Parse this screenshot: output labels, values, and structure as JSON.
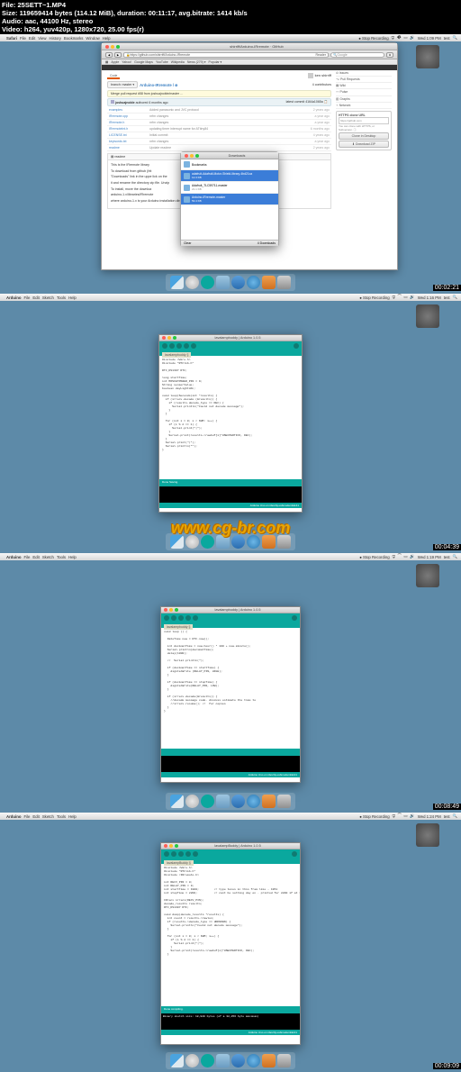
{
  "file_info": {
    "file": "File: 25SETT~1.MP4",
    "size": "Size: 119659414 bytes (114.12 MiB), duration: 00:11:17, avg.bitrate: 1414 kb/s",
    "audio": "Audio: aac, 44100 Hz, stereo",
    "video": "Video: h264, yuv420p, 1280x720, 25.00 fps(r)"
  },
  "timestamps": [
    "00:02:21",
    "00:04:39",
    "00:08:49",
    "00:09:09"
  ],
  "watermark": "www.cg-br.com",
  "panel1": {
    "menubar": {
      "app": "Safari",
      "items": [
        "File",
        "Edit",
        "View",
        "History",
        "Bookmarks",
        "Window",
        "Help"
      ],
      "recording": "● Stop Recording",
      "clock": "Wed 1:09 PM",
      "user": "test"
    },
    "safari": {
      "title": "shirriff/Arduino-IRremote · GitHub",
      "url": "https://github.com/shirriff/Arduino-IRremote",
      "search_ph": "Google",
      "reader": "Reader",
      "bookmarks": [
        "Apple",
        "Yahoo!",
        "Google Maps",
        "YouTube",
        "Wikipedia",
        "News (279) ▾",
        "Popular ▾"
      ],
      "github_nav": [
        "🔍 shirriff ▾",
        "★",
        "🔔"
      ],
      "gh_user": "ken shirriff",
      "tabs": [
        "Code",
        "Network",
        "Pull Requests 5",
        "Issues 25",
        "Wiki",
        "Graphs"
      ],
      "branch_btn": "branch: master ▾",
      "path": "Arduino-IRremote / ⊕",
      "contributors": "4 contributors",
      "merge_msg": "Merge pull request #58 from joshuajnoble/master …",
      "commit_user": "joshuajnoble",
      "commit_age": "authored 6 months ago",
      "latest_commit": "latest commit  4164a1065a 📋",
      "side": {
        "issues": "⊙ Issues",
        "pulls": "⌥ Pull Requests",
        "wiki": "▤ Wiki",
        "pulse": "〰 Pulse",
        "graphs": "▥ Graphs",
        "network": "♆ Network"
      },
      "clone_label": "HTTPS clone URL",
      "clone_url": "https://github.com",
      "clone_note": "You can clone with HTTPS, or Subversion. ⓘ",
      "clone_desktop": "Clone in Desktop",
      "download_zip": "⬇ Download ZIP",
      "files": [
        {
          "name": "examples",
          "msg": "Added panasonic and JVC protocol",
          "age": "2 years ago"
        },
        {
          "name": "IRremote.cpp",
          "msg": "nrfm changes",
          "age": "a year ago"
        },
        {
          "name": "IRremote.h",
          "msg": "nrfm changes",
          "age": "a year ago"
        },
        {
          "name": "IRremoteInt.h",
          "msg": "updating timer interrupt name for ATtiny84",
          "age": "6 months ago"
        },
        {
          "name": "LICENSE.txt",
          "msg": "Initial commit",
          "age": "4 years ago"
        },
        {
          "name": "keywords.txt",
          "msg": "nrfm changes",
          "age": "a year ago"
        },
        {
          "name": "readme",
          "msg": "Update readme",
          "age": "2 years ago"
        }
      ],
      "readme_head": "▤ readme",
      "readme": [
        "This is the IRremote library",
        "To download from github (htt",
        "\"Downloads\" link in the uppe                                                  lick on the",
        "it and rename the directory                                                    zip file. Unzip",
        "To install, move the downloa",
        "arduino-1.x/libraries/IRremote",
        "where arduino-1.x is your Arduino installation directory"
      ]
    },
    "downloads": {
      "title": "Downloads",
      "items": [
        {
          "name": "Bookmarks",
          "sub": ""
        },
        {
          "name": "adafruit-Adafruit-Motor-Shield-library-4bd21ca",
          "sub": "12.3 KB"
        },
        {
          "name": "Adafruit_TLC59711-master",
          "sub": "21.1 KB"
        },
        {
          "name": "Arduino-IRremote-master",
          "sub": "53.4 KB"
        }
      ],
      "clear": "Clear",
      "count": "4 Downloads"
    }
  },
  "arduino_menubar": {
    "app": "Arduino",
    "items": [
      "File",
      "Edit",
      "Sketch",
      "Tools",
      "Help"
    ],
    "recording": "● Stop Recording"
  },
  "panel2": {
    "clock": "Wed 1:16 PM",
    "user": "test",
    "title": "lavalampbuddy | Arduino 1.0.5",
    "tab": "lavalampbuddy §",
    "status": "Arduino Uno on /dev/tty.usbmodemfa141",
    "code": "#include <Wire.h>\n#include \"RTClib.h\"\n\nRTC_DS1307 RTC;\n\nlong startTime;\nint MOSFETPOWER_PIN = 9;\nString sensorValue;\nboolean dayLightsOn;\n\nvoid loop(Seconds(int *results) {\n  if (irrecv.decode (&results)) {\n    if (results.decode_type == NEC) {\n      Serial.println(\"Could not decode message\");\n    }\n  }\n\n  for (int i = 0; i < NUM: i++) {\n    if (i % 2 == 1) {\n      Serial.print(\"|\");\n    }\n    Serial.print(results->rawbuf[i]*USECPERTICK, DEC);\n  }\n  Serial.print(\"|\");\n  Serial.println(\"\");\n}"
  },
  "panel3": {
    "clock": "Wed 1:19 PM",
    "user": "test",
    "title": "lavalampbuddy | Arduino 1.0.5",
    "tab": "lavalampbuddy §",
    "status": "Arduino Uno on /dev/tty.usbmodemfa141",
    "code": "void loop () {\n\n  DateTime now = RTC.now();\n\n  int decimalTime = now.hour() * 100 + now.minute();\n  Serial.println(decimalTime);\n  delay(1000);\n\n  //  Serial.println(\");\n\n  if (decimalTime == startTime) {\n    digitalWrite (RELAY_PIN, HIGH);\n  }\n\n  if (decimalTime == stopTime) {\n    digitalWrite(RELAY_PIN, LOW);\n  }\n\n  if (irrecv.decode(&results)) {\n    //decode message code. discuss estimate the time to\n    //irrecv.resume(); //  for copies\n  }\n}"
  },
  "panel4": {
    "clock": "Wed 1:24 PM",
    "user": "test",
    "title": "lavalampBuddy | Arduino 1.0.5",
    "tab": "lavalampBuddy §",
    "status": "Arduino Uno on /dev/tty.usbmodemfa141",
    "console_head": "Done compiling.",
    "console": "Binary sketch size: 18,920 bytes (of a 32,256 byte maximum)",
    "code": "#include <Wire.h>\n#include \"RTClib.h\"\n#include <IRremote.h>\n\nint RECV_PIN = 8;\nint RELAY_PIN = 9;\nint startTime = 1900;         // type tones in this fram like - 1951\nint stopTime = 2200;          // cant be setting day on . printed for 2200 if at 10 pm\n\nIRrecv irrecv(RECV_PIN);\ndecode_results results;\nRTC_DS1307 RTC;\n\nvoid dump(decode_results *results) {\n  int count = results->rawlen;\n  if (results->decode_type == UNKNOWN) {\n    Serial.println(\"Could not decode message\");\n  }\n\n  for (int i = 0; i < NUM; i++) {\n    if (i % 2 == 1) {\n      Serial.print(\"|\");\n    }\n    Serial.print(results->rawbuf[i]*USECPERTICK, DEC);\n  }"
  },
  "chart_data": null
}
